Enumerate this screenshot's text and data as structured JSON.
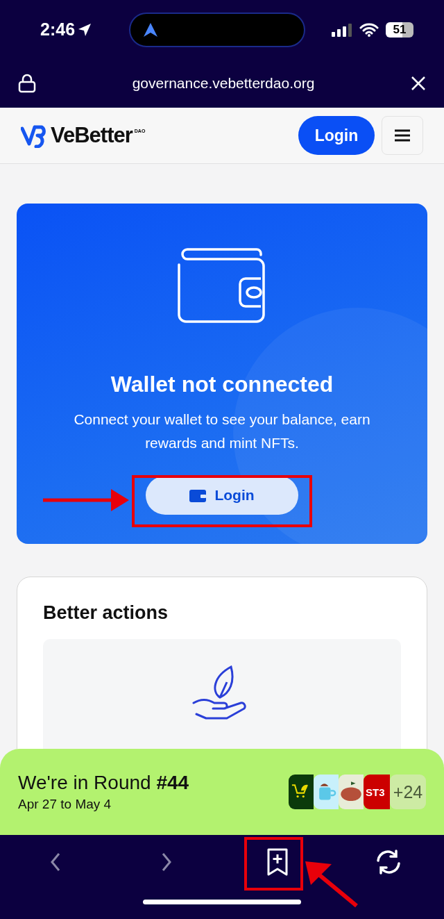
{
  "status_bar": {
    "time": "2:46",
    "battery": "51"
  },
  "browser": {
    "url": "governance.vebetterdao.org"
  },
  "header": {
    "logo": "VeBetter",
    "logo_suffix": "DAO",
    "login": "Login"
  },
  "wallet_card": {
    "title": "Wallet not connected",
    "text": "Connect your wallet to see your balance, earn rewards and mint NFTs.",
    "button": "Login"
  },
  "actions_card": {
    "title": "Better actions"
  },
  "round_banner": {
    "title": "We're in Round **#44**",
    "dates": "Apr 27 to May 4",
    "apps": [
      {
        "kind": "cart",
        "color": "#0b3a0b"
      },
      {
        "kind": "mug",
        "color": "#c8f0fb"
      },
      {
        "kind": "steak",
        "color": "#e8ecd8"
      },
      {
        "kind": "text",
        "color": "#cc0000",
        "label": "ST3"
      }
    ],
    "more": "+24"
  },
  "toolbar": {
    "back_disabled": true,
    "forward_disabled": true
  }
}
